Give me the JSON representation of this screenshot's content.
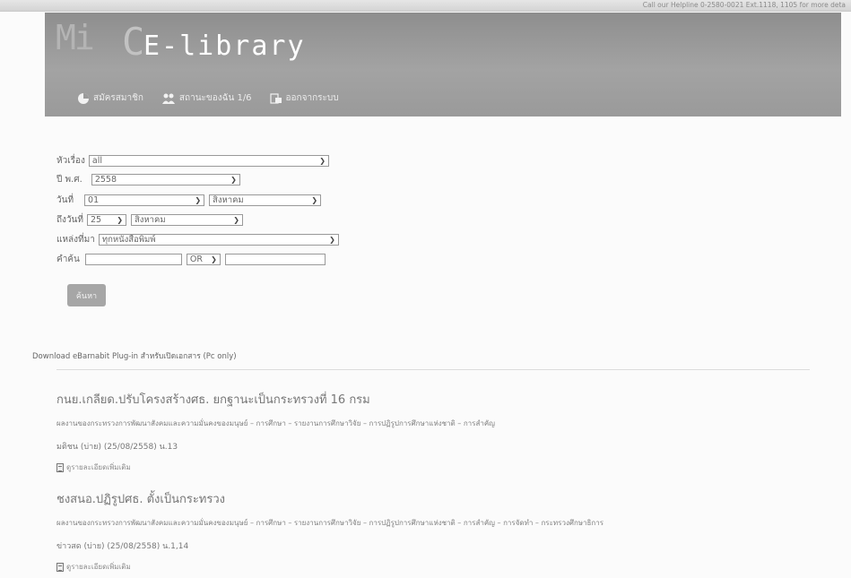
{
  "topbar": {
    "hotline": "Call our Helpline 0-2580-0021 Ext.1118, 1105 for more deta"
  },
  "header": {
    "logo": "Mi",
    "logo_c": "C",
    "title": "E-library",
    "nav": [
      {
        "label": "สมัครสมาชิก",
        "icon": "pie-chart-icon"
      },
      {
        "label": "สถานะของฉัน 1/6",
        "icon": "users-icon"
      },
      {
        "label": "ออกจากระบบ",
        "icon": "logout-icon"
      }
    ]
  },
  "form": {
    "topic": {
      "label": "หัวเรื่อง",
      "value": "all"
    },
    "year": {
      "label": "ปี พ.ศ.",
      "value": "2558"
    },
    "start": {
      "label": "วันที่",
      "day": "01",
      "month": "สิงหาคม"
    },
    "end": {
      "label": "ถึงวันที่",
      "day": "25",
      "month": "สิงหาคม"
    },
    "source": {
      "label": "แหล่งที่มา",
      "value": "ทุกหนังสือพิมพ์"
    },
    "keyword": {
      "label": "คำค้น",
      "operator": "OR"
    },
    "search_label": "ค้นหา"
  },
  "download_text": "Download eBarnabit Plug-in สำหรับเปิดเอกสาร (Pc only)",
  "results": [
    {
      "title": "กนย.เกลียด.ปรับโครงสร้างศธ. ยกฐานะเป็นกระทรวงที่ 16 กรม",
      "meta": "ผลงานของกระทรวงการพัฒนาสังคมและความมั่นคงของมนุษย์ – การศึกษา – รายงานการศึกษาวิจัย – การปฏิรูปการศึกษาแห่งชาติ – การสำคัญ",
      "pub": "มติชน (บ่าย) (25/08/2558) น.13",
      "link": "ดูรายละเอียดเพิ่มเติม"
    },
    {
      "title": "ชงสนอ.ปฏิรูปศธ. ตั้งเป็นกระทรวง",
      "meta": "ผลงานของกระทรวงการพัฒนาสังคมและความมั่นคงของมนุษย์ – การศึกษา – รายงานการศึกษาวิจัย – การปฏิรูปการศึกษาแห่งชาติ – การสำคัญ – การจัดทำ – กระทรวงศึกษาธิการ",
      "pub": "ข่าวสด (บ่าย) (25/08/2558) น.1,14",
      "link": "ดูรายละเอียดเพิ่มเติม"
    }
  ]
}
